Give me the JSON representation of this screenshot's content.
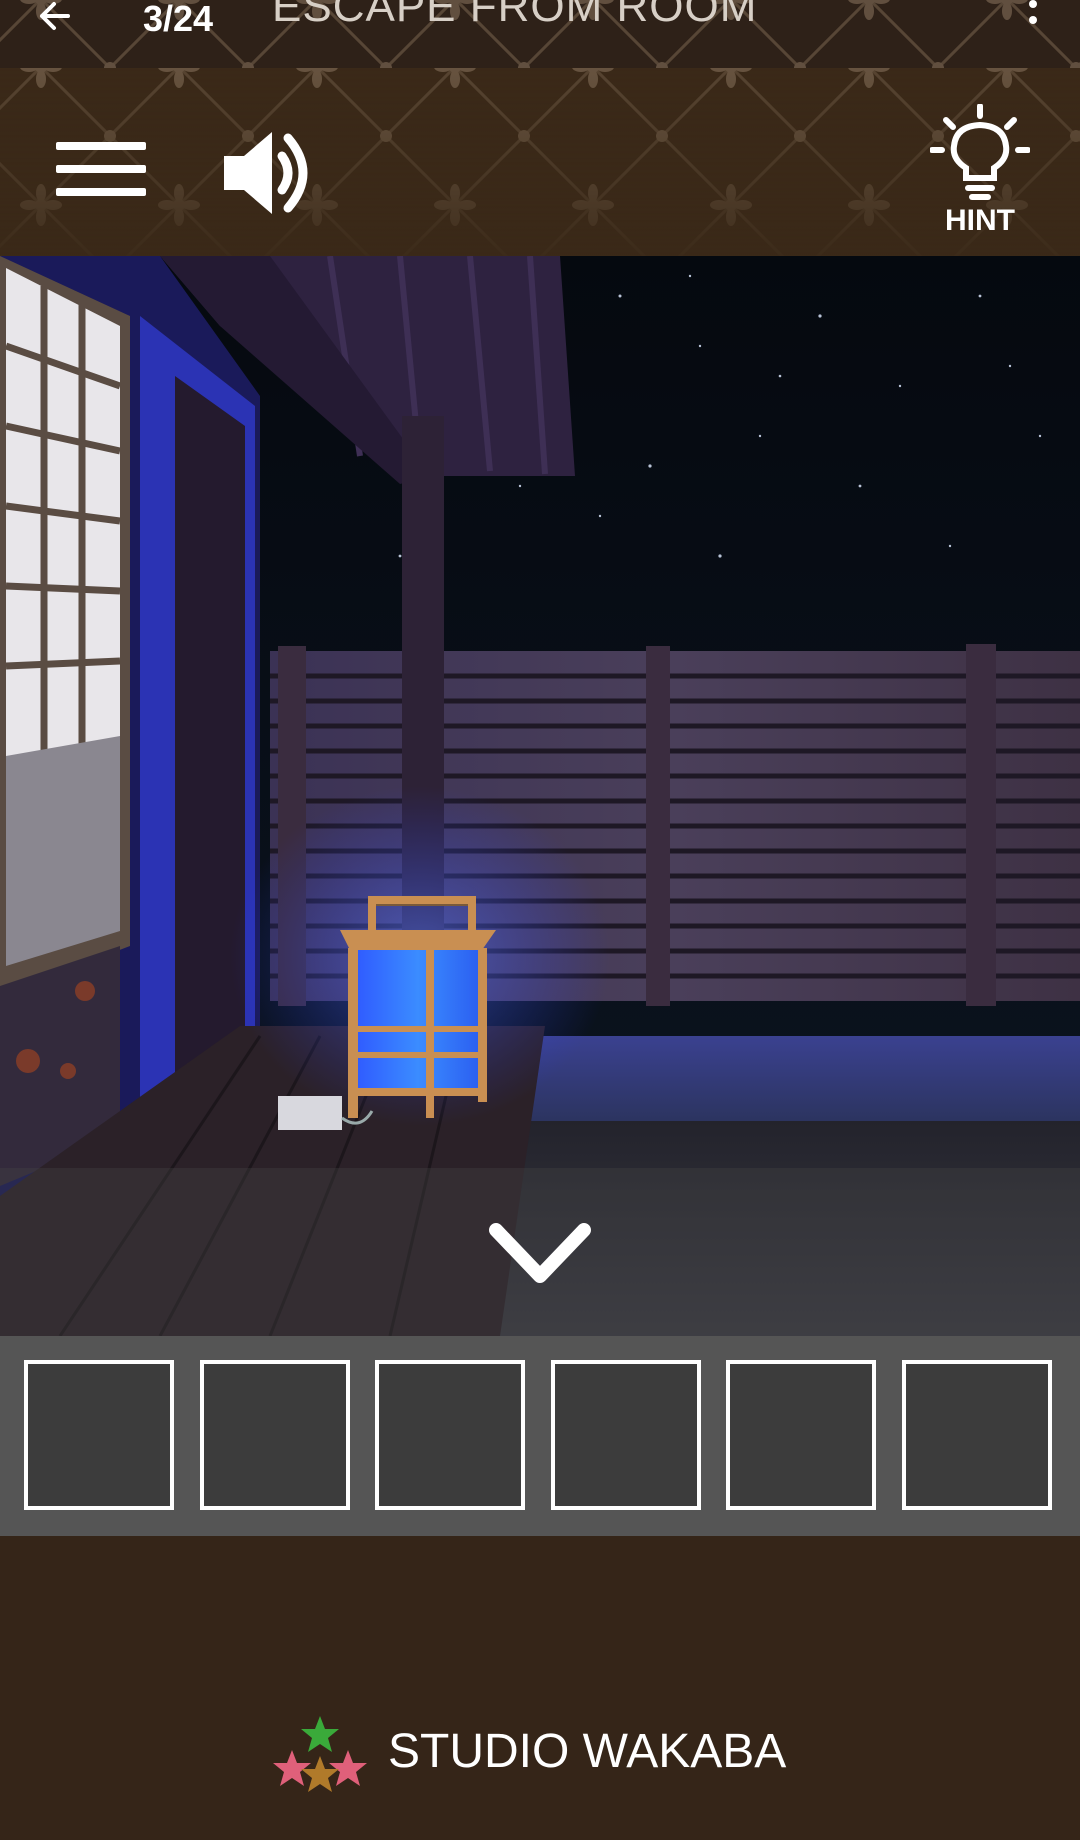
{
  "appbar": {
    "back_icon": "arrow-left-icon",
    "page_count": "3/24",
    "title": "ESCAPE FROM ROOM",
    "overflow_icon": "more-vert-icon"
  },
  "toolbar": {
    "menu_icon": "hamburger-menu-icon",
    "sound_icon": "speaker-volume-icon",
    "hint_icon": "lightbulb-icon",
    "hint_label": "HINT"
  },
  "scene": {
    "description_icon": "night-garden-veranda-lantern",
    "nav_icon": "chevron-down-icon"
  },
  "inventory": {
    "slot_count": 6
  },
  "footer": {
    "logo_icon": "stars-leaf-logo",
    "studio_name": "STUDIO WAKABA"
  },
  "colors": {
    "header_brown": "#3a2918",
    "footer_brown": "#352518",
    "inventory_gray": "#555555",
    "slot_fill": "#3c3c3c",
    "lantern_blue": "#3a6cff"
  }
}
